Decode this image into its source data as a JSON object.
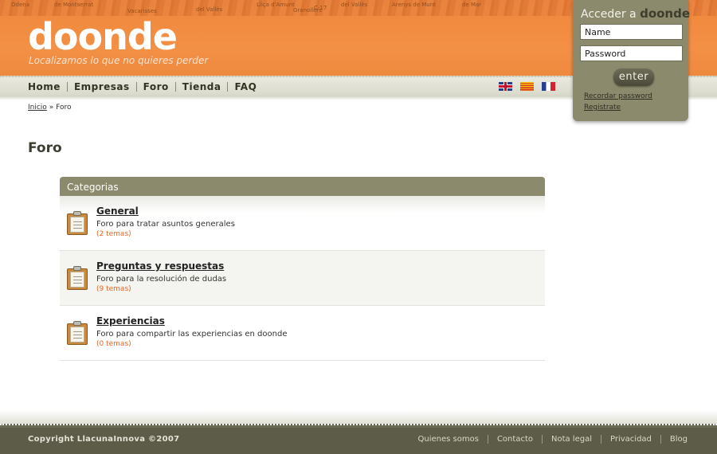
{
  "header": {
    "logo": "doonde",
    "tagline": "Localizamos lo que no quieres perder",
    "map_labels": [
      "Odena",
      "de Montserrat",
      "Vacarisses",
      "del Vallès",
      "Lliça d'Amunt",
      "Granollers",
      "C-17",
      "del Vallès",
      "Arenys de Munt",
      "de Mar"
    ]
  },
  "nav": {
    "items": [
      "Home",
      "Empresas",
      "Foro",
      "Tienda",
      "FAQ"
    ],
    "flags": [
      "uk-flag-icon",
      "catalan-flag-icon",
      "france-flag-icon"
    ]
  },
  "login": {
    "title": "Acceder a",
    "brand": "doonde",
    "name_value": "Name",
    "password_value": "Password",
    "enter_label": "enter",
    "forgot_link": "Recordar password",
    "register_link": "Registrate"
  },
  "breadcrumb": {
    "home": "Inicio",
    "separator": "»",
    "current": "Foro"
  },
  "page_title": "Foro",
  "forum": {
    "header": "Categorias",
    "categories": [
      {
        "title": "General",
        "description": "Foro para tratar asuntos generales",
        "count": "(2 temas)"
      },
      {
        "title": "Preguntas y respuestas",
        "description": "Foro para la resolución de dudas",
        "count": "(9 temas)"
      },
      {
        "title": "Experiencias",
        "description": "Foro para compartir las experiencias en doonde",
        "count": "(0 temas)"
      }
    ]
  },
  "footer": {
    "copyright": "Copyright LlacunaInnova ©2007",
    "links": [
      "Quienes somos",
      "Contacto",
      "Nota legal",
      "Privacidad",
      "Blog"
    ]
  },
  "colors": {
    "brand_orange": "#f08a3e",
    "olive": "#8b8a6d",
    "footer": "#5d5c48",
    "count_orange": "#e8661f"
  }
}
